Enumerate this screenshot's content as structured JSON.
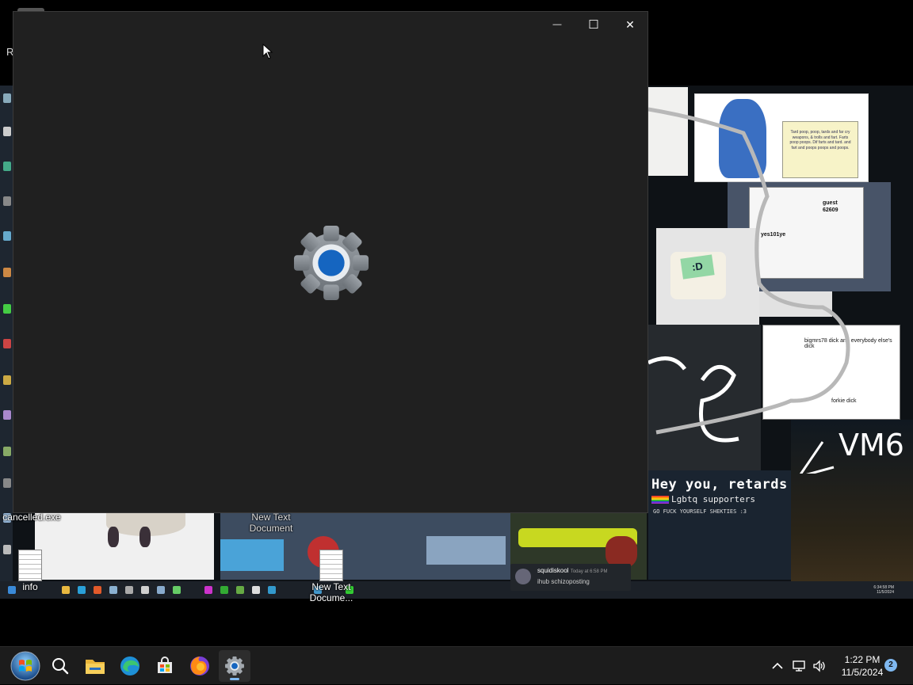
{
  "desktop": {
    "edge_letter": "R",
    "icons": [
      {
        "label": "cancelled.exe"
      },
      {
        "label": "New Text Document"
      },
      {
        "label": "info"
      },
      {
        "label": "New Text Docume..."
      }
    ]
  },
  "wallpaper": {
    "cat_note": "Tard poop, poop, tards and far cry weapons, & trolls and fart. Farts poop poops. Dif farts and tard. and fart and poops poops and poops.",
    "guest_label": "guest",
    "guest_number": "62609",
    "guest_label2": "yes101ye",
    "bot_screen": ":D",
    "dick_label1": "bigmrs78 dick and everybody else's dick",
    "dick_label2": "forkie dick",
    "vm_label": "VM6",
    "banner_title": "Hey you, retards",
    "banner_subtitle": "Lgbtq supporters",
    "banner_small": "GO FUCK YOURSELF SHEKTIES :3",
    "chat_name": "squidiskool",
    "chat_time": "Today at 6:58 PM",
    "chat_message": "ihub schizoposting",
    "inner_clock_time": "6:34:58 PM",
    "inner_clock_date": "11/5/2024"
  },
  "settings_window": {
    "minimize_glyph": "—",
    "maximize_glyph": "☐",
    "close_glyph": "✕"
  },
  "taskbar": {
    "time": "1:22 PM",
    "date": "11/5/2024",
    "notification_count": "2",
    "tray_chevron": "^"
  },
  "colors": {
    "window_bg": "#202020",
    "taskbar_bg": "#1c1c1c",
    "accent": "#7fb8f0",
    "gear_blue": "#1565c0"
  }
}
